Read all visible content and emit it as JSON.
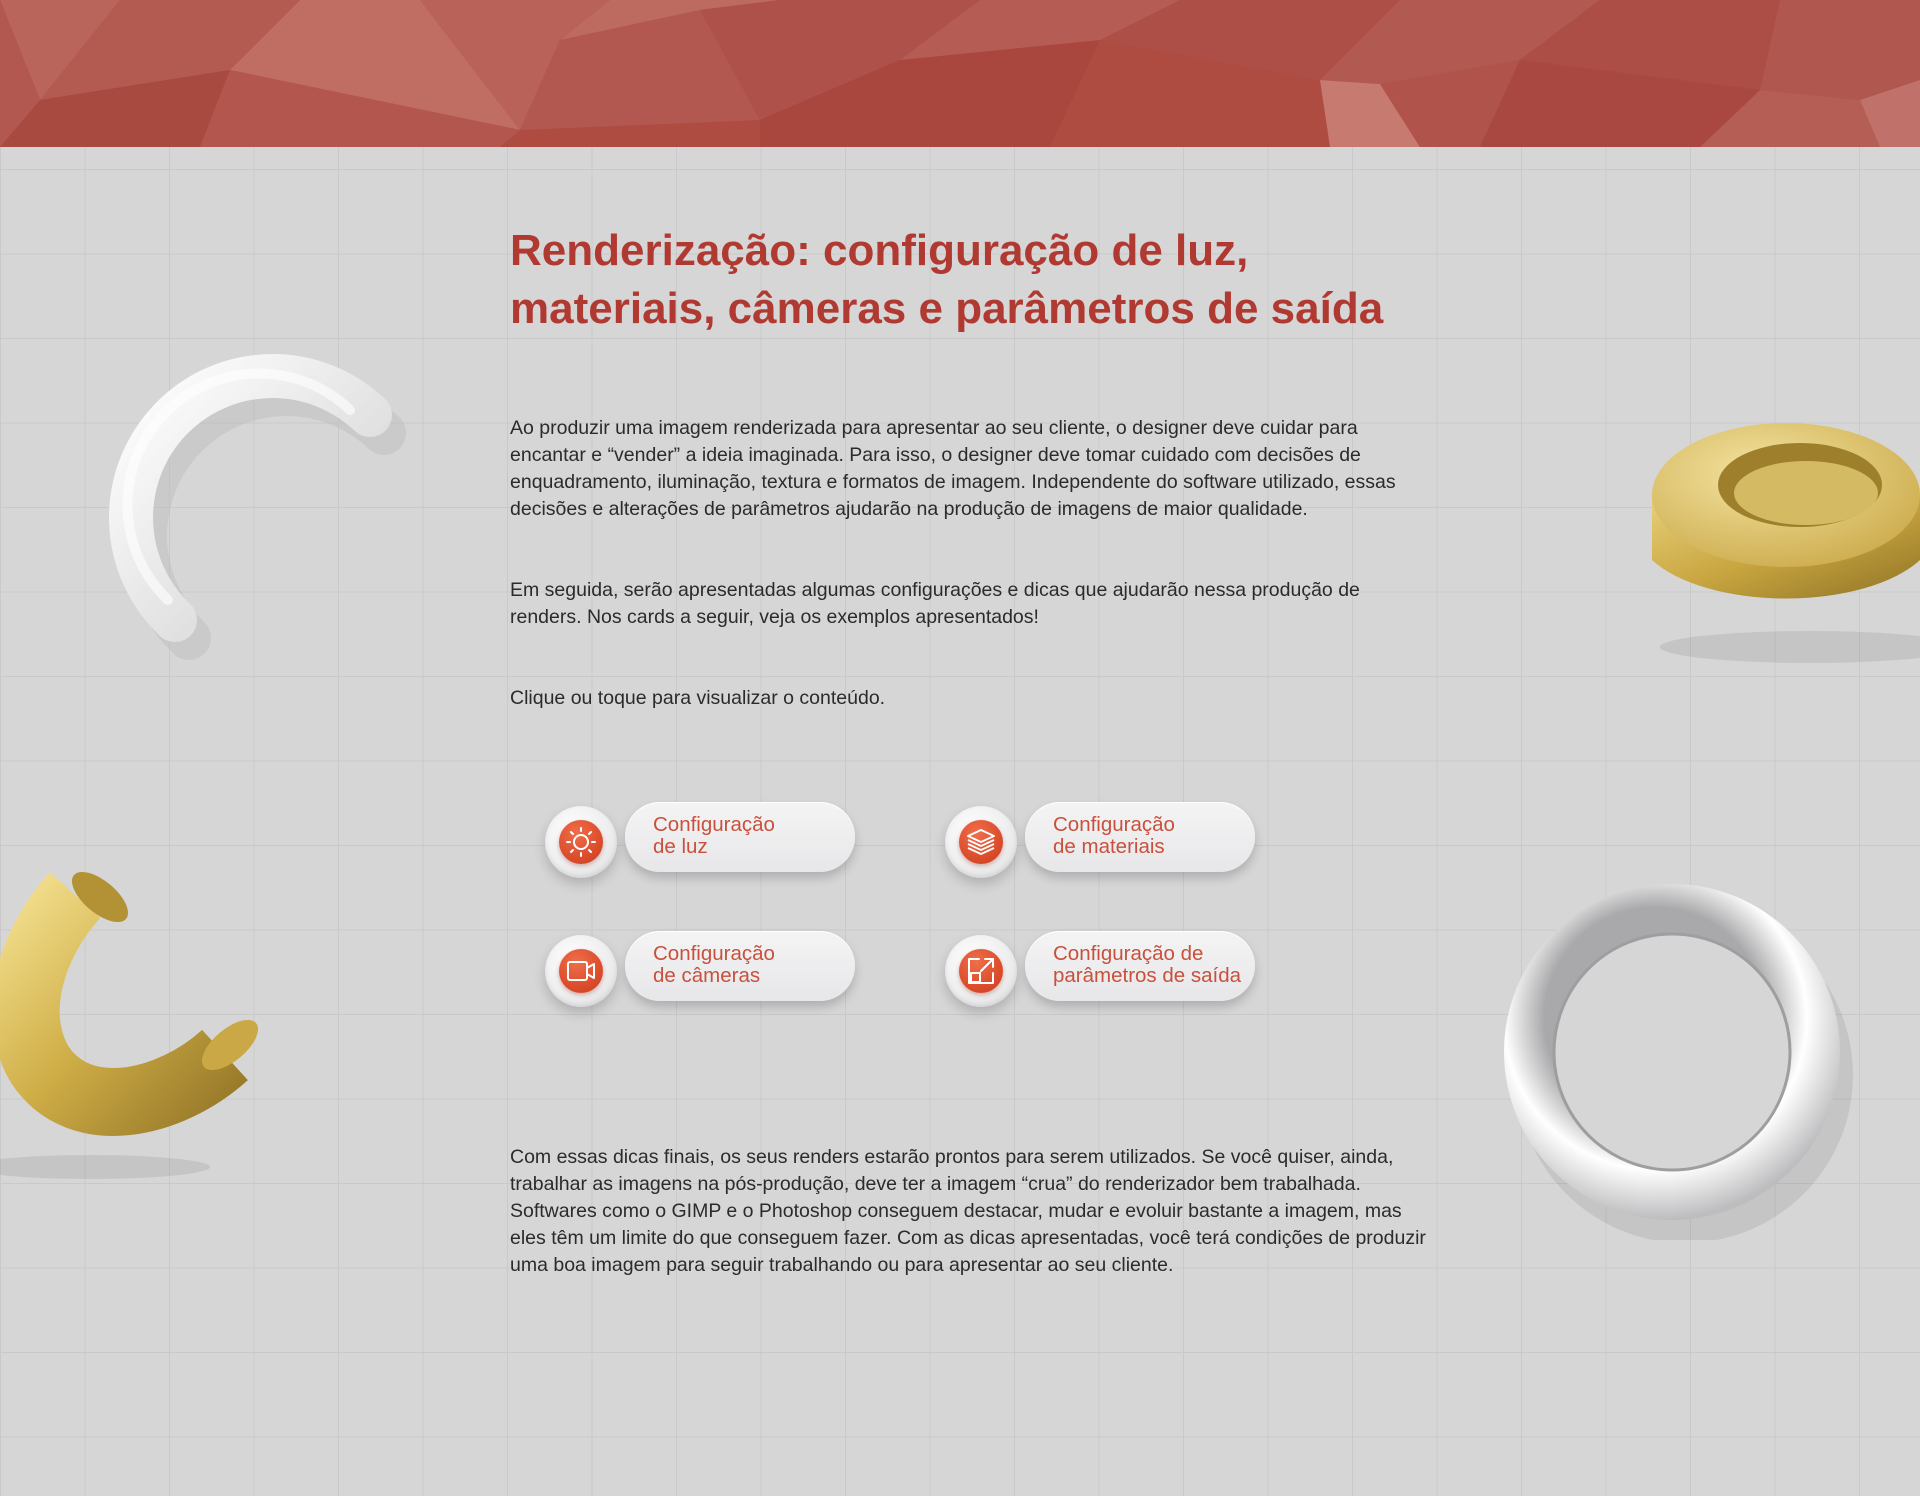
{
  "title": "Renderização: configuração de luz, materiais, câmeras e parâmetros de saída",
  "paragraphs": {
    "intro": "Ao produzir uma imagem renderizada para apresentar ao seu cliente, o designer deve cuidar para encantar e “vender” a ideia imaginada. Para isso, o designer deve tomar cuidado com decisões de enquadramento, iluminação, textura e formatos de imagem. Independente do software utilizado, essas decisões e alterações de parâmetros ajudarão na produção de imagens de maior qualidade.",
    "next": "Em seguida, serão apresentadas algumas configurações e dicas que ajudarão nessa produção de renders. Nos cards a seguir, veja os exemplos apresentados!",
    "instruction": "Clique ou toque para visualizar o conteúdo.",
    "closing": "Com essas dicas finais, os seus renders estarão prontos para serem utilizados. Se você quiser, ainda, trabalhar as imagens na pós-produção, deve ter a imagem “crua” do renderizador bem trabalhada. Softwares como o GIMP e o Photoshop conseguem destacar, mudar e evoluir bastante a imagem, mas eles têm um limite do que conseguem fazer. Com as dicas apresentadas, você terá condições de produzir uma boa imagem para seguir trabalhando ou para apresentar ao seu cliente."
  },
  "cards": [
    {
      "label_line1": "Configuração",
      "label_line2": "de luz",
      "icon": "sun-icon"
    },
    {
      "label_line1": "Configuração",
      "label_line2": "de materiais",
      "icon": "layers-icon"
    },
    {
      "label_line1": "Configuração",
      "label_line2": "de câmeras",
      "icon": "video-camera-icon"
    },
    {
      "label_line1": "Configuração de",
      "label_line2": "parâmetros de saída",
      "icon": "resize-icon"
    }
  ],
  "colors": {
    "header": "#ae4c42",
    "title": "#b03a31",
    "accent": "#dc4d2c",
    "background": "#d6d6d7",
    "gold": "#d4b451"
  }
}
